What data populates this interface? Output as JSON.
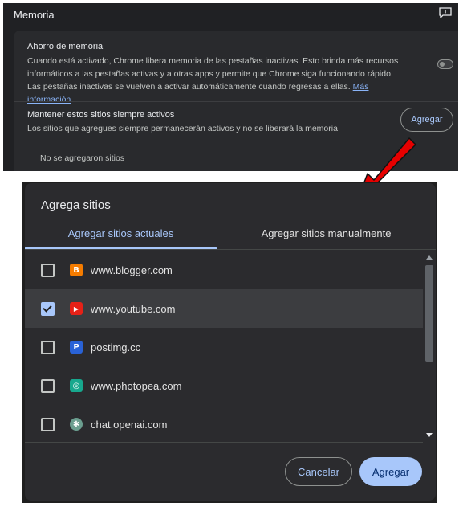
{
  "settings": {
    "section_title": "Memoria",
    "memory_saver": {
      "title": "Ahorro de memoria",
      "description": "Cuando está activado, Chrome libera memoria de las pestañas inactivas. Esto brinda más recursos informáticos a las pestañas activas y a otras apps y permite que Chrome siga funcionando rápido. Las pestañas inactivas se vuelven a activar automáticamente cuando regresas a ellas. ",
      "link": "Más información",
      "enabled": false
    },
    "always_active": {
      "title": "Mantener estos sitios siempre activos",
      "description": "Los sitios que agregues siempre permanecerán activos y no se liberará la memoria",
      "add_button": "Agregar",
      "empty_text": "No se agregaron sitios"
    }
  },
  "dialog": {
    "title": "Agrega sitios",
    "tabs": [
      {
        "label": "Agregar sitios actuales",
        "active": true
      },
      {
        "label": "Agregar sitios manualmente",
        "active": false
      }
    ],
    "sites": [
      {
        "url": "www.blogger.com",
        "checked": false,
        "icon": "blogger-icon",
        "color": "#f57c00",
        "glyph": "B"
      },
      {
        "url": "www.youtube.com",
        "checked": true,
        "icon": "youtube-icon",
        "color": "#e62117",
        "glyph": "▶"
      },
      {
        "url": "postimg.cc",
        "checked": false,
        "icon": "postimg-icon",
        "color": "#2962d6",
        "glyph": "P"
      },
      {
        "url": "www.photopea.com",
        "checked": false,
        "icon": "photopea-icon",
        "color": "#17a88e",
        "glyph": "◎"
      },
      {
        "url": "chat.openai.com",
        "checked": false,
        "icon": "openai-icon",
        "color": "#6b9e8f",
        "glyph": "✱"
      }
    ],
    "cancel_label": "Cancelar",
    "add_label": "Agregar"
  },
  "colors": {
    "accent": "#a8c7fa",
    "annotation_arrow": "#e60000"
  }
}
